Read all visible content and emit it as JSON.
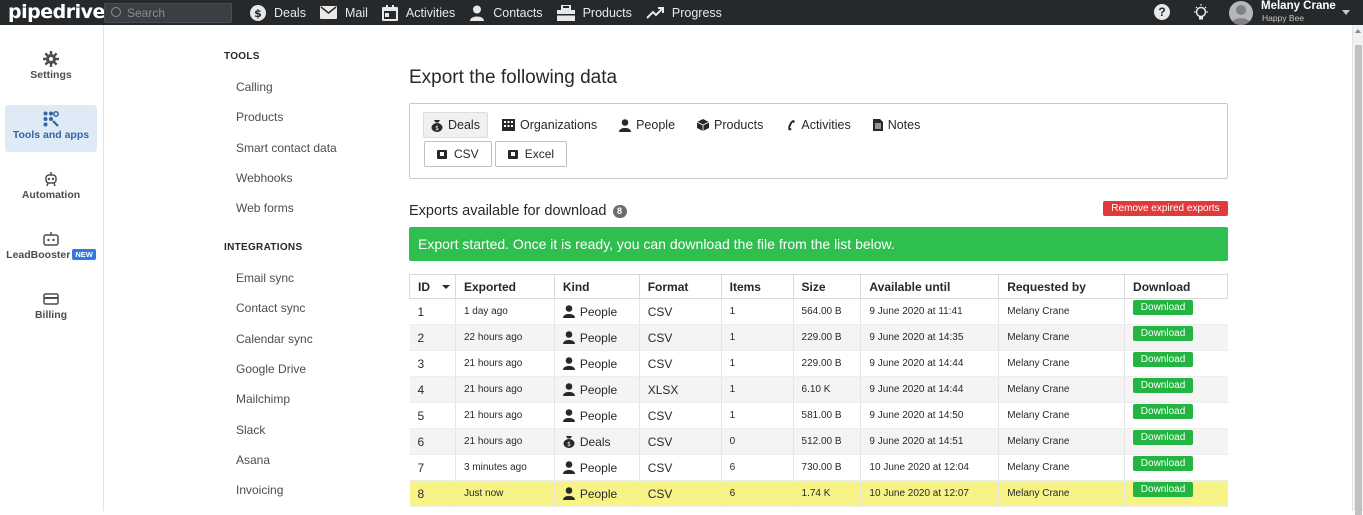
{
  "topbar": {
    "logo": "pipedrive",
    "search_placeholder": "Search",
    "nav": [
      {
        "label": "Deals",
        "icon": "dollar-icon"
      },
      {
        "label": "Mail",
        "icon": "mail-icon"
      },
      {
        "label": "Activities",
        "icon": "calendar-icon"
      },
      {
        "label": "Contacts",
        "icon": "person-icon"
      },
      {
        "label": "Products",
        "icon": "box-icon"
      },
      {
        "label": "Progress",
        "icon": "trend-icon"
      }
    ],
    "help": "?",
    "user_name": "Melany Crane",
    "user_company": "Happy Bee"
  },
  "rail": {
    "items": [
      {
        "label": "Settings",
        "icon": "gear-icon"
      },
      {
        "label": "Tools and apps",
        "icon": "tools-icon"
      },
      {
        "label": "Automation",
        "icon": "robot-icon"
      },
      {
        "label": "LeadBooster",
        "icon": "chatbot-icon",
        "badge": "NEW"
      },
      {
        "label": "Billing",
        "icon": "card-icon"
      }
    ]
  },
  "subnav": {
    "tools_heading": "TOOLS",
    "tools": [
      "Calling",
      "Products",
      "Smart contact data",
      "Webhooks",
      "Web forms"
    ],
    "integrations_heading": "INTEGRATIONS",
    "integrations": [
      "Email sync",
      "Contact sync",
      "Calendar sync",
      "Google Drive",
      "Mailchimp",
      "Slack",
      "Asana",
      "Invoicing"
    ]
  },
  "main": {
    "title": "Export the following data",
    "tabs": [
      {
        "label": "Deals",
        "icon": "money-bag-icon"
      },
      {
        "label": "Organizations",
        "icon": "building-icon"
      },
      {
        "label": "People",
        "icon": "person-icon"
      },
      {
        "label": "Products",
        "icon": "cube-icon"
      },
      {
        "label": "Activities",
        "icon": "phone-icon"
      },
      {
        "label": "Notes",
        "icon": "note-icon"
      }
    ],
    "formats": [
      "CSV",
      "Excel"
    ],
    "exports_title": "Exports available for download",
    "exports_count": "8",
    "remove_button": "Remove expired exports",
    "banner": "Export started. Once it is ready, you can download the file from the list below."
  },
  "table": {
    "headers": [
      "ID",
      "Exported",
      "Kind",
      "Format",
      "Items",
      "Size",
      "Available until",
      "Requested by",
      "Download"
    ],
    "download_label": "Download",
    "rows": [
      {
        "id": "1",
        "exported": "1 day ago",
        "kind": "People",
        "format": "CSV",
        "items": "1",
        "size": "564.00 B",
        "until": "9 June 2020 at 11:41",
        "by": "Melany Crane"
      },
      {
        "id": "2",
        "exported": "22 hours ago",
        "kind": "People",
        "format": "CSV",
        "items": "1",
        "size": "229.00 B",
        "until": "9 June 2020 at 14:35",
        "by": "Melany Crane"
      },
      {
        "id": "3",
        "exported": "21 hours ago",
        "kind": "People",
        "format": "CSV",
        "items": "1",
        "size": "229.00 B",
        "until": "9 June 2020 at 14:44",
        "by": "Melany Crane"
      },
      {
        "id": "4",
        "exported": "21 hours ago",
        "kind": "People",
        "format": "XLSX",
        "items": "1",
        "size": "6.10 K",
        "until": "9 June 2020 at 14:44",
        "by": "Melany Crane"
      },
      {
        "id": "5",
        "exported": "21 hours ago",
        "kind": "People",
        "format": "CSV",
        "items": "1",
        "size": "581.00 B",
        "until": "9 June 2020 at 14:50",
        "by": "Melany Crane"
      },
      {
        "id": "6",
        "exported": "21 hours ago",
        "kind": "Deals",
        "format": "CSV",
        "items": "0",
        "size": "512.00 B",
        "until": "9 June 2020 at 14:51",
        "by": "Melany Crane"
      },
      {
        "id": "7",
        "exported": "3 minutes ago",
        "kind": "People",
        "format": "CSV",
        "items": "6",
        "size": "730.00 B",
        "until": "10 June 2020 at 12:04",
        "by": "Melany Crane"
      },
      {
        "id": "8",
        "exported": "Just now",
        "kind": "People",
        "format": "CSV",
        "items": "6",
        "size": "1.74 K",
        "until": "10 June 2020 at 12:07",
        "by": "Melany Crane",
        "highlighted": true
      }
    ]
  },
  "colors": {
    "topbar": "#26292c",
    "success": "#2ebf4f",
    "download": "#23b441",
    "danger": "#e03b3b",
    "highlight": "#f8f386",
    "active_rail": "#dfeaf7"
  }
}
